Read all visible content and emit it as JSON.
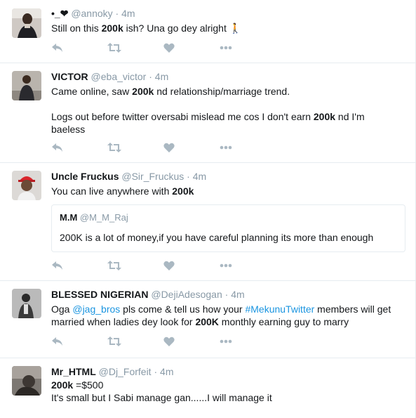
{
  "icon_color": "#aab8c2",
  "tweets": [
    {
      "name": "•_❤",
      "handle": "@annoky",
      "time": "4m",
      "line1": [
        "Still on this ",
        "200k",
        " ish? Una go dey alright 🚶"
      ]
    },
    {
      "name": "VICTOR",
      "handle": "@eba_victor",
      "time": "4m",
      "line1": [
        "Came online, saw ",
        "200k",
        " nd relationship/marriage trend."
      ],
      "line2": [
        "Logs out before twitter oversabi mislead me cos I don't earn ",
        "200k",
        " nd I'm"
      ],
      "line3": "baeless"
    },
    {
      "name": "Uncle Fruckus",
      "handle": "@Sir_Fruckus",
      "time": "4m",
      "line1": [
        "You can live anywhere with ",
        "200k"
      ],
      "quote": {
        "name": "M.M",
        "handle": "@M_M_Raj",
        "text": "200K is a lot of money,if you have careful planning its more than enough"
      }
    },
    {
      "name": "BLESSED NIGERIAN",
      "handle": "@DejiAdesogan",
      "time": "4m",
      "line1": [
        "Oga ",
        "@jag_bros",
        " pls come & tell us how your ",
        "#MekunuTwitter",
        " members will get"
      ],
      "line2": [
        "married when ladies dey look for ",
        "200K",
        " monthly earning guy to marry"
      ]
    },
    {
      "name": "Mr_HTML",
      "handle": "@Dj_Forfeit",
      "time": "4m",
      "line1": [
        "200k",
        " =$500"
      ],
      "line2": "It's small but I Sabi manage gan......I will manage it"
    }
  ]
}
